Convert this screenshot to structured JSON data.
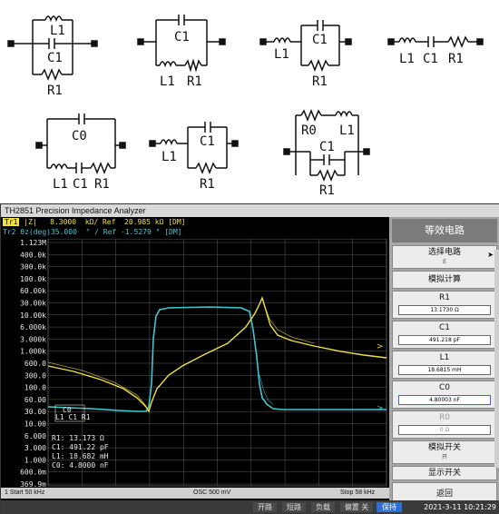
{
  "circuits": {
    "c1": {
      "l1": "L1",
      "c1": "C1",
      "r1": "R1"
    },
    "c2": {
      "c1": "C1",
      "l1": "L1",
      "r1": "R1"
    },
    "c3": {
      "l1": "L1",
      "c1": "C1",
      "r1": "R1"
    },
    "c4": {
      "l1": "L1",
      "c1": "C1",
      "r1": "R1"
    },
    "c5": {
      "c0": "C0",
      "l1": "L1",
      "c1": "C1",
      "r1": "R1"
    },
    "c6": {
      "l1": "L1",
      "c1": "C1",
      "r1": "R1"
    },
    "c7": {
      "r0": "R0",
      "l1": "L1",
      "c1": "C1",
      "r1": "R1"
    }
  },
  "analyzer": {
    "title": "TH2851 Precision Impedance Analyzer",
    "trace1": {
      "tag": "Tr1",
      "text": " |Z|   8.3000  kΩ/ Ref  20.985 kΩ [DM]"
    },
    "trace2": {
      "tag": "Tr2",
      "text": " θz(deg)35.000  ° / Ref -1.5279 ° [DM]"
    },
    "y_ticks": [
      "1.123M",
      "400.0k",
      "300.0k",
      "100.0k",
      "60.00k",
      "30.00k",
      "10.00k",
      "6.000k",
      "3.000k",
      "1.000k",
      "600.0",
      "300.0",
      "100.0",
      "60.00",
      "30.00",
      "10.00",
      "6.000",
      "3.000",
      "1.000",
      "600.0m",
      "369.9m"
    ],
    "marker": {
      "r1": "R1: 13.173 Ω",
      "c1": "C1: 491.22 pF",
      "l1": "L1: 18.682 mH",
      "c0": "C0: 4.8000 nF"
    },
    "mini_circuit": {
      "c0": "C0",
      "row": "L1 C1 R1"
    },
    "status": {
      "start": "1  Start 50 kHz",
      "osc": "OSC 500 mV",
      "stop": "Stop  58 kHz"
    }
  },
  "softkeys": {
    "title": "等效电路",
    "select_circuit": {
      "label": "选择电路",
      "value": "E"
    },
    "simulate": {
      "label": "模拟计算"
    },
    "r1": {
      "label": "R1",
      "value": "13.1730 Ω"
    },
    "c1": {
      "label": "C1",
      "value": "491.218 pF"
    },
    "l1": {
      "label": "L1",
      "value": "18.6815 mH"
    },
    "c0": {
      "label": "C0",
      "value": "4.80003 nF"
    },
    "r0": {
      "label": "R0",
      "value": "0 Ω"
    },
    "sim_switch": {
      "label": "模拟开关",
      "value": "开"
    },
    "display_switch": {
      "label": "显示开关"
    },
    "back": {
      "label": "返回"
    }
  },
  "bottom": {
    "open": "开路",
    "short": "短路",
    "load": "负载",
    "bias": "偏置 关",
    "hold": "保持",
    "datetime": "2021-3-11 10:21:29"
  },
  "colors": {
    "trace1": "#f0e040",
    "trace2": "#40c8d0",
    "hold": "#2c6fd6"
  }
}
